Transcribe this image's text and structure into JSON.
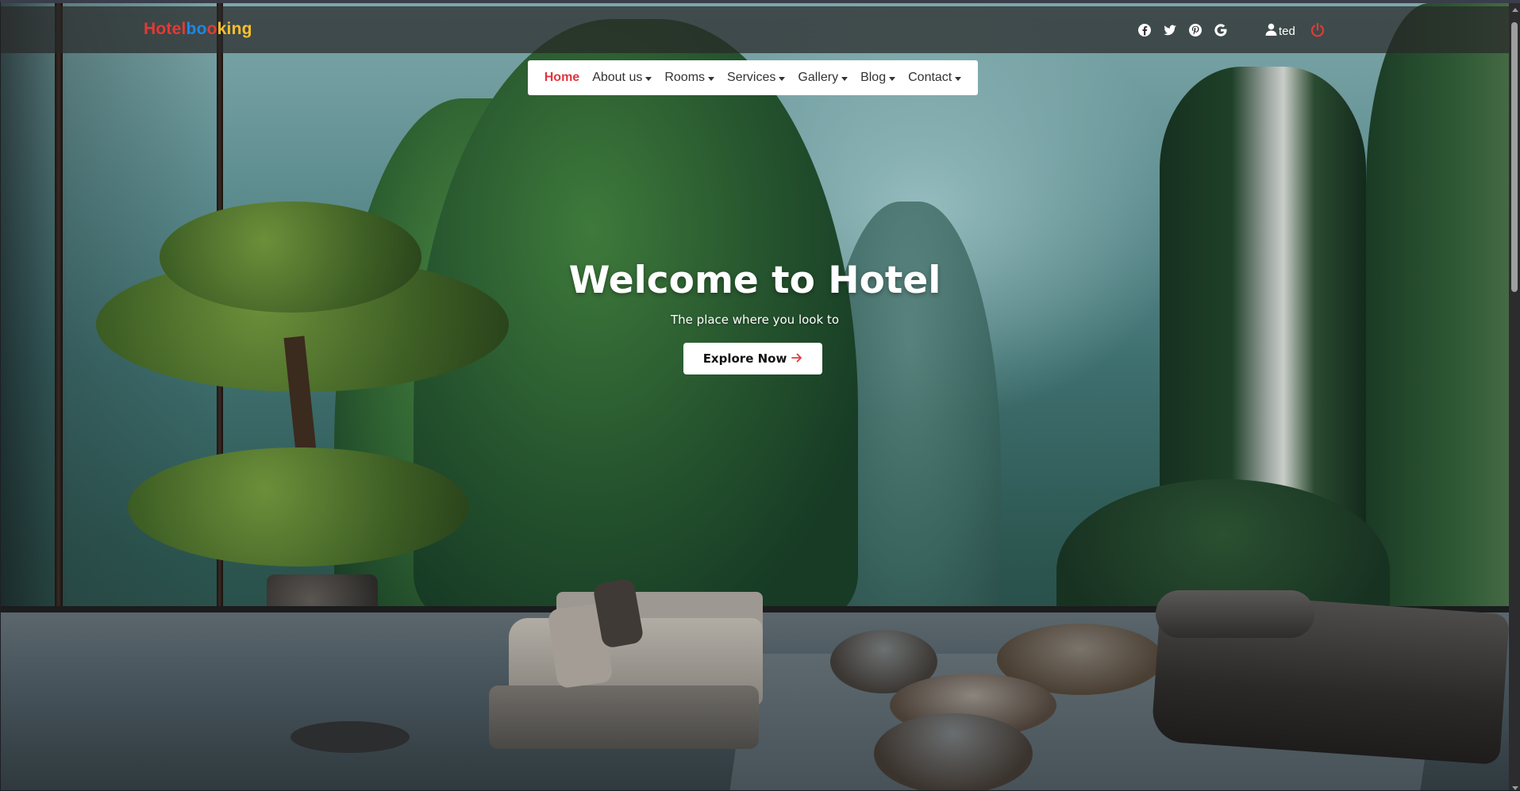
{
  "brand": {
    "letters": [
      {
        "ch": "H",
        "color": "#e53935"
      },
      {
        "ch": "o",
        "color": "#e53935"
      },
      {
        "ch": "t",
        "color": "#e53935"
      },
      {
        "ch": "e",
        "color": "#e53935"
      },
      {
        "ch": "l",
        "color": "#e53935"
      },
      {
        "ch": "b",
        "color": "#1e88e5"
      },
      {
        "ch": "o",
        "color": "#1e88e5"
      },
      {
        "ch": "o",
        "color": "#e53935"
      },
      {
        "ch": "k",
        "color": "#fbc02d"
      },
      {
        "ch": "i",
        "color": "#fbc02d"
      },
      {
        "ch": "n",
        "color": "#fbc02d"
      },
      {
        "ch": "g",
        "color": "#fbc02d"
      }
    ]
  },
  "social": [
    {
      "name": "facebook-icon"
    },
    {
      "name": "twitter-icon"
    },
    {
      "name": "pinterest-icon"
    },
    {
      "name": "google-icon"
    }
  ],
  "user": {
    "name": "ted",
    "icon": "user-icon"
  },
  "logout": {
    "icon": "power-icon",
    "color": "#e53935"
  },
  "nav": {
    "items": [
      {
        "label": "Home",
        "active": true,
        "dropdown": false
      },
      {
        "label": "About us",
        "active": false,
        "dropdown": true
      },
      {
        "label": "Rooms",
        "active": false,
        "dropdown": true
      },
      {
        "label": "Services",
        "active": false,
        "dropdown": true
      },
      {
        "label": "Gallery",
        "active": false,
        "dropdown": true
      },
      {
        "label": "Blog",
        "active": false,
        "dropdown": true
      },
      {
        "label": "Contact",
        "active": false,
        "dropdown": true
      }
    ],
    "active_color": "#e0353e"
  },
  "hero": {
    "title": "Welcome to Hotel",
    "subtitle": "The place where you look to",
    "cta_label": "Explore Now",
    "cta_icon": "arrow-right-icon",
    "cta_icon_color": "#e53935"
  }
}
